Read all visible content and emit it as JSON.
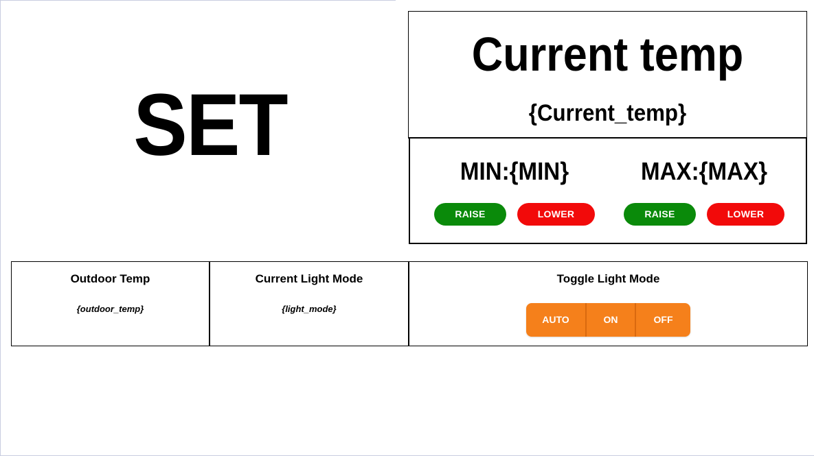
{
  "set_panel": {
    "title": "SET"
  },
  "current_temp": {
    "heading": "Current temp",
    "value": "{Current_temp}"
  },
  "min": {
    "label": "MIN:{MIN}",
    "raise_label": "RAISE",
    "lower_label": "LOWER"
  },
  "max": {
    "label": "MAX:{MAX}",
    "raise_label": "RAISE",
    "lower_label": "LOWER"
  },
  "outdoor": {
    "title": "Outdoor Temp",
    "value": "{outdoor_temp}"
  },
  "light_mode": {
    "title": "Current Light Mode",
    "value": "{light_mode}"
  },
  "toggle_light": {
    "title": "Toggle Light Mode",
    "options": [
      "AUTO",
      "ON",
      "OFF"
    ]
  },
  "colors": {
    "raise": "#0a8a0a",
    "lower": "#f20a0a",
    "toggle": "#f5801b"
  }
}
